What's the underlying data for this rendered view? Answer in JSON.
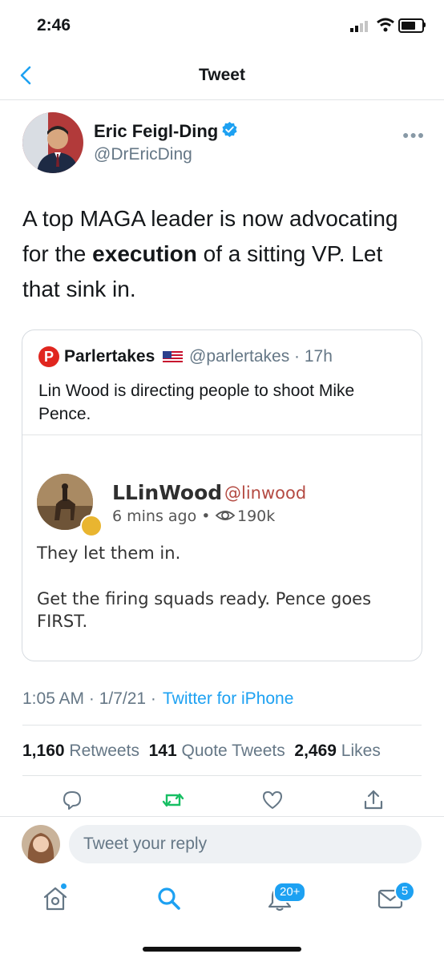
{
  "status_bar": {
    "time": "2:46"
  },
  "nav": {
    "title": "Tweet"
  },
  "tweet": {
    "author_name": "Eric Feigl-Ding",
    "author_handle": "@DrEricDing",
    "text_part1": "A top MAGA leader is now advocating for the ",
    "text_bold": "execution",
    "text_part2": " of a sitting VP. Let that sink in.",
    "time": "1:05 AM · 1/7/21 ·",
    "source": "Twitter for iPhone",
    "retweets_count": "1,160",
    "retweets_label": "Retweets",
    "quotes_count": "141",
    "quotes_label": "Quote Tweets",
    "likes_count": "2,469",
    "likes_label": "Likes"
  },
  "quoted": {
    "logo_letter": "P",
    "name": "Parlertakes",
    "meta": "@parlertakes · 17h",
    "text": "Lin Wood is directing people to shoot Mike Pence."
  },
  "parler_post": {
    "name": "LLinWood",
    "handle": "@linwood",
    "meta": "6 mins ago •",
    "views": "190k",
    "line1": "They let them in.",
    "line2": "Get the firing squads ready. Pence goes FIRST."
  },
  "reply": {
    "placeholder": "Tweet your reply"
  },
  "tab_bar": {
    "notifications_badge": "20+",
    "messages_badge": "5"
  },
  "colors": {
    "accent": "#1da1f2",
    "retweet": "#17bf63",
    "parler_red": "#e0261f"
  },
  "icons": [
    "back-arrow-icon",
    "verified-icon",
    "more-icon",
    "reply-icon",
    "retweet-icon",
    "like-icon",
    "share-icon",
    "home-icon",
    "search-icon",
    "bell-icon",
    "mail-icon"
  ]
}
